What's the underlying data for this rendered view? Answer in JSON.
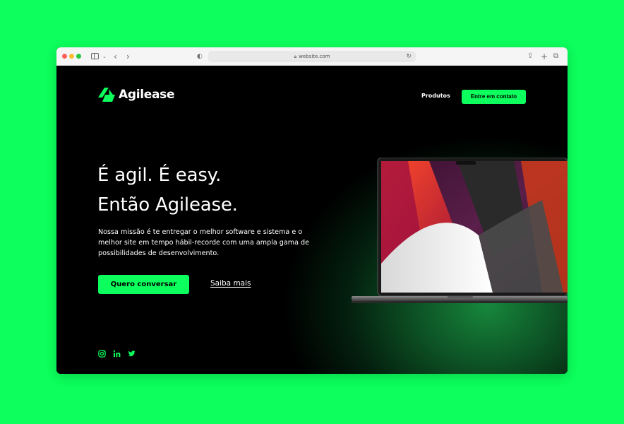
{
  "browser": {
    "url": "website.com"
  },
  "brand": {
    "name": "Agilease",
    "accent": "#0cff5c",
    "background": "#000000"
  },
  "nav": {
    "products_label": "Produtos",
    "contact_label": "Entre em contato"
  },
  "hero": {
    "headline_line1": "É agil. É easy.",
    "headline_line2": "Então Agilease.",
    "description": "Nossa missão é te entregar o melhor software e sistema e o melhor site em tempo hábil-recorde com uma ampla gama de possibilidades de desenvolvimento.",
    "primary_button": "Quero conversar",
    "secondary_link": "Saiba mais"
  },
  "socials": [
    {
      "icon": "instagram-icon"
    },
    {
      "icon": "linkedin-icon"
    },
    {
      "icon": "twitter-icon"
    }
  ]
}
